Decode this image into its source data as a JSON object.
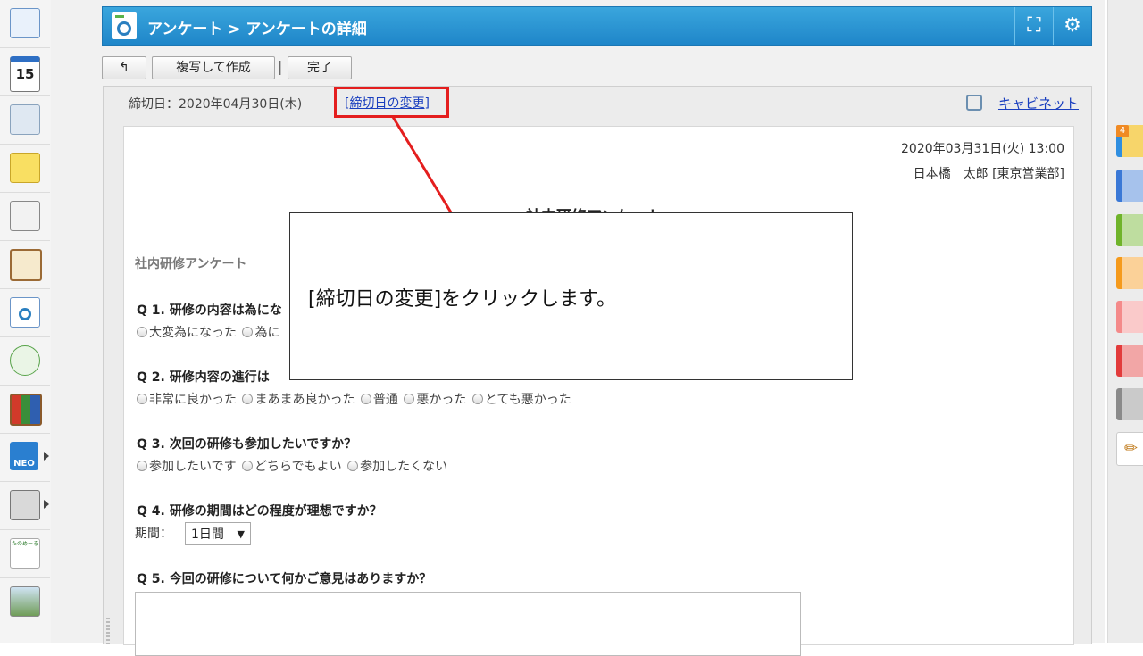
{
  "header": {
    "title": "アンケート > アンケートの詳細",
    "fullscreen_icon": "⛶",
    "settings_icon": "⚙"
  },
  "toolbar": {
    "back_label": "↰",
    "copy_label": "複写して作成",
    "separator": "|",
    "done_label": "完了"
  },
  "deadline": {
    "label": "締切日：2020年04月30日(木)",
    "change_link": "[締切日の変更]",
    "cabinet_link": "キャビネット"
  },
  "survey": {
    "datetime": "2020年03月31日(火) 13:00",
    "author": "日本橋　太郎 [東京営業部]",
    "title": "社内研修アンケート",
    "section_title": "社内研修アンケート",
    "questions": [
      {
        "label": "Q 1. 研修の内容は為にな",
        "options": [
          "大変為になった",
          "為に"
        ]
      },
      {
        "label": "Q 2. 研修内容の進行は",
        "options": [
          "非常に良かった",
          "まあまあ良かった",
          "普通",
          "悪かった",
          "とても悪かった"
        ]
      },
      {
        "label": "Q 3. 次回の研修も参加したいですか？",
        "options": [
          "参加したいです",
          "どちらでもよい",
          "参加したくない"
        ]
      },
      {
        "label": "Q 4. 研修の期間はどの程度が理想ですか？",
        "period_label": "期間：",
        "period_value": "1日間",
        "period_arrow": "▼"
      },
      {
        "label": "Q 5. 今回の研修について何かご意見はありますか？"
      }
    ]
  },
  "callout": {
    "text": "[締切日の変更]をクリックします。"
  },
  "left_icons": [
    {
      "name": "portal",
      "label": ""
    },
    {
      "name": "calendar",
      "label": "15"
    },
    {
      "name": "facility",
      "label": ""
    },
    {
      "name": "memo",
      "label": ""
    },
    {
      "name": "bulletin",
      "label": ""
    },
    {
      "name": "clipboard",
      "label": ""
    },
    {
      "name": "survey",
      "label": ""
    },
    {
      "name": "workflow",
      "label": ""
    },
    {
      "name": "cabinet-books",
      "label": ""
    },
    {
      "name": "neo",
      "label": "NEO"
    },
    {
      "name": "folder",
      "label": ""
    },
    {
      "name": "tanomail",
      "label": "たのめーる"
    },
    {
      "name": "banner",
      "label": ""
    }
  ],
  "colors": {
    "header_blue": "#2a93d3",
    "highlight_red": "#e41e1e",
    "link_blue": "#1a3fbf"
  },
  "right_tabs": [
    {
      "color": "#2f8ee0",
      "badge": "4"
    },
    {
      "color": "#3a78d6"
    },
    {
      "color": "#6fb32a"
    },
    {
      "color": "#f59a1c"
    },
    {
      "color": "#f48a8a"
    },
    {
      "color": "#e23b3b"
    },
    {
      "color": "#8a8a8a"
    },
    {
      "color": "#ffffff",
      "icon": "✏"
    }
  ]
}
